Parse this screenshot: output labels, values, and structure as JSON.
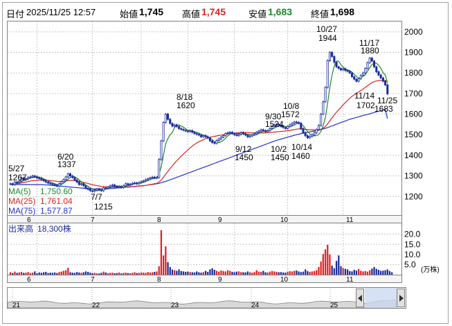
{
  "header": {
    "date_label": "日付",
    "datetime": "2025/11/25 12:57",
    "open_label": "始値",
    "open": "1,745",
    "high_label": "高値",
    "high": "1,745",
    "low_label": "安値",
    "low": "1,683",
    "close_label": "終値",
    "close": "1,698"
  },
  "ma_legend": [
    {
      "label": "MA(5)",
      "value": "1,750.60",
      "color": "#1a8a2a"
    },
    {
      "label": "MA(25)",
      "value": "1,761.04",
      "color": "#e02020"
    },
    {
      "label": "MA(75)",
      "value": "1,577.87",
      "color": "#2030d0"
    }
  ],
  "volume": {
    "title": "出来高",
    "value": "18,300株",
    "unit": "(万株)",
    "y_ticks": [
      "20.0",
      "15.0",
      "10.0",
      "5.0"
    ]
  },
  "colors": {
    "candle_up": "#ffffff",
    "candle_down": "#1a2aa0",
    "ma5": "#1a8a2a",
    "ma25": "#e02020",
    "ma75": "#2030d0",
    "volume_up": "#e02020",
    "volume_down": "#1a2aa0",
    "grid": "#c8c8c8"
  },
  "chart_data": {
    "type": "candlestick",
    "y_ticks": [
      1200,
      1300,
      1400,
      1500,
      1600,
      1700,
      1800,
      1900,
      2000
    ],
    "ylim": [
      1110,
      2050
    ],
    "x_month_labels": [
      "6",
      "7",
      "8",
      "9",
      "10",
      "11"
    ],
    "grid": true,
    "annotations": [
      {
        "date": "5/27",
        "price": 1267
      },
      {
        "date": "6/20",
        "price": 1337
      },
      {
        "date": "7/7",
        "price": 1215
      },
      {
        "date": "8/18",
        "price": 1620
      },
      {
        "date": "9/12",
        "price": 1450
      },
      {
        "date": "9/30",
        "price": 1524
      },
      {
        "date": "10/2",
        "price": 1450
      },
      {
        "date": "10/8",
        "price": 1572
      },
      {
        "date": "10/14",
        "price": 1460
      },
      {
        "date": "10/27",
        "price": 1944
      },
      {
        "date": "11/17",
        "price": 1880
      },
      {
        "date": "11/14",
        "price": 1702
      },
      {
        "date": "11/25",
        "price": 1683
      }
    ],
    "closes": [
      1262,
      1258,
      1270,
      1268,
      1275,
      1290,
      1282,
      1286,
      1292,
      1295,
      1300,
      1296,
      1290,
      1288,
      1282,
      1276,
      1270,
      1265,
      1262,
      1258,
      1255,
      1250,
      1262,
      1272,
      1282,
      1295,
      1310,
      1300,
      1292,
      1280,
      1270,
      1258,
      1262,
      1252,
      1240,
      1235,
      1228,
      1225,
      1230,
      1236,
      1232,
      1228,
      1242,
      1240,
      1246,
      1252,
      1256,
      1250,
      1246,
      1248,
      1244,
      1252,
      1262,
      1256,
      1260,
      1264,
      1266,
      1262,
      1268,
      1272,
      1276,
      1282,
      1286,
      1290,
      1294,
      1290,
      1292,
      1380,
      1470,
      1560,
      1600,
      1575,
      1555,
      1542,
      1548,
      1540,
      1530,
      1526,
      1522,
      1518,
      1515,
      1520,
      1512,
      1506,
      1502,
      1498,
      1490,
      1496,
      1490,
      1484,
      1470,
      1462,
      1458,
      1472,
      1480,
      1488,
      1496,
      1506,
      1510,
      1512,
      1506,
      1500,
      1496,
      1502,
      1510,
      1505,
      1498,
      1490,
      1494,
      1500,
      1505,
      1512,
      1518,
      1524,
      1520,
      1515,
      1520,
      1530,
      1542,
      1548,
      1550,
      1545,
      1540,
      1535,
      1530,
      1540,
      1548,
      1555,
      1562,
      1560,
      1556,
      1530,
      1510,
      1495,
      1485,
      1492,
      1500,
      1510,
      1525,
      1545,
      1600,
      1660,
      1730,
      1860,
      1900,
      1880,
      1852,
      1830,
      1822,
      1815,
      1820,
      1812,
      1808,
      1800,
      1782,
      1770,
      1760,
      1772,
      1788,
      1800,
      1822,
      1850,
      1872,
      1858,
      1830,
      1806,
      1790,
      1776,
      1760,
      1742,
      1698
    ],
    "ma5": [
      1262,
      1260,
      1263,
      1265,
      1267,
      1272,
      1277,
      1280,
      1285,
      1291,
      1291,
      1294,
      1295,
      1294,
      1291,
      1286,
      1281,
      1276,
      1270,
      1266,
      1262,
      1258,
      1257,
      1259,
      1264,
      1273,
      1284,
      1292,
      1296,
      1295,
      1290,
      1280,
      1272,
      1264,
      1256,
      1249,
      1243,
      1236,
      1233,
      1231,
      1230,
      1230,
      1234,
      1236,
      1238,
      1242,
      1247,
      1249,
      1250,
      1250,
      1249,
      1248,
      1250,
      1252,
      1255,
      1259,
      1262,
      1262,
      1264,
      1266,
      1269,
      1273,
      1277,
      1282,
      1286,
      1288,
      1290,
      1309,
      1345,
      1400,
      1456,
      1481,
      1500,
      1510,
      1535,
      1546,
      1548,
      1542,
      1537,
      1529,
      1522,
      1520,
      1518,
      1514,
      1512,
      1508,
      1502,
      1497,
      1494,
      1490,
      1484,
      1476,
      1467,
      1463,
      1462,
      1466,
      1473,
      1483,
      1494,
      1502,
      1507,
      1507,
      1506,
      1505,
      1506,
      1505,
      1503,
      1502,
      1501,
      1499,
      1498,
      1500,
      1506,
      1512,
      1516,
      1518,
      1519,
      1522,
      1527,
      1532,
      1538,
      1543,
      1545,
      1544,
      1540,
      1538,
      1539,
      1542,
      1547,
      1553,
      1556,
      1553,
      1544,
      1530,
      1515,
      1505,
      1497,
      1494,
      1496,
      1502,
      1516,
      1544,
      1585,
      1653,
      1730,
      1790,
      1834,
      1858,
      1857,
      1840,
      1828,
      1820,
      1815,
      1811,
      1804,
      1794,
      1783,
      1776,
      1777,
      1784,
      1791,
      1808,
      1826,
      1840,
      1850,
      1847,
      1838,
      1822,
      1802,
      1790,
      1751
    ],
    "ma25": [
      1262,
      1261,
      1262,
      1263,
      1264,
      1266,
      1268,
      1270,
      1272,
      1275,
      1277,
      1278,
      1278,
      1279,
      1279,
      1279,
      1279,
      1278,
      1277,
      1276,
      1275,
      1274,
      1273,
      1273,
      1274,
      1275,
      1277,
      1278,
      1278,
      1277,
      1275,
      1273,
      1271,
      1268,
      1266,
      1263,
      1260,
      1257,
      1255,
      1253,
      1251,
      1249,
      1248,
      1247,
      1246,
      1245,
      1245,
      1244,
      1244,
      1244,
      1244,
      1244,
      1245,
      1245,
      1246,
      1247,
      1248,
      1249,
      1250,
      1251,
      1252,
      1254,
      1256,
      1258,
      1260,
      1262,
      1264,
      1270,
      1280,
      1293,
      1308,
      1322,
      1336,
      1349,
      1362,
      1374,
      1385,
      1396,
      1406,
      1416,
      1426,
      1436,
      1445,
      1453,
      1460,
      1466,
      1471,
      1476,
      1481,
      1485,
      1488,
      1490,
      1492,
      1494,
      1496,
      1498,
      1500,
      1502,
      1504,
      1506,
      1507,
      1508,
      1509,
      1510,
      1511,
      1511,
      1511,
      1511,
      1510,
      1510,
      1509,
      1509,
      1509,
      1509,
      1509,
      1509,
      1510,
      1511,
      1512,
      1513,
      1514,
      1515,
      1516,
      1517,
      1518,
      1519,
      1521,
      1523,
      1525,
      1527,
      1528,
      1528,
      1527,
      1526,
      1525,
      1524,
      1524,
      1523,
      1523,
      1524,
      1527,
      1532,
      1540,
      1553,
      1568,
      1582,
      1596,
      1609,
      1621,
      1633,
      1645,
      1656,
      1667,
      1677,
      1686,
      1694,
      1701,
      1708,
      1715,
      1722,
      1730,
      1738,
      1746,
      1753,
      1758,
      1761,
      1763,
      1764,
      1764,
      1763,
      1761
    ],
    "ma75": [
      1258,
      1258,
      1258,
      1258,
      1258,
      1258,
      1258,
      1258,
      1258,
      1258,
      1258,
      1258,
      1258,
      1258,
      1258,
      1257,
      1256,
      1256,
      1255,
      1254,
      1253,
      1252,
      1251,
      1250,
      1249,
      1248,
      1247,
      1246,
      1245,
      1244,
      1243,
      1242,
      1241,
      1240,
      1239,
      1238,
      1238,
      1237,
      1237,
      1237,
      1237,
      1237,
      1237,
      1238,
      1238,
      1239,
      1239,
      1240,
      1241,
      1242,
      1243,
      1244,
      1245,
      1246,
      1247,
      1248,
      1249,
      1250,
      1251,
      1252,
      1253,
      1254,
      1256,
      1257,
      1259,
      1260,
      1262,
      1264,
      1267,
      1270,
      1273,
      1277,
      1281,
      1285,
      1289,
      1293,
      1297,
      1301,
      1305,
      1309,
      1313,
      1317,
      1321,
      1325,
      1329,
      1333,
      1337,
      1341,
      1345,
      1349,
      1353,
      1357,
      1361,
      1365,
      1369,
      1373,
      1377,
      1381,
      1385,
      1389,
      1393,
      1397,
      1401,
      1405,
      1409,
      1413,
      1417,
      1421,
      1425,
      1429,
      1433,
      1437,
      1441,
      1445,
      1449,
      1453,
      1457,
      1461,
      1465,
      1469,
      1473,
      1476,
      1479,
      1482,
      1485,
      1488,
      1491,
      1494,
      1497,
      1500,
      1503,
      1506,
      1508,
      1510,
      1512,
      1514,
      1516,
      1518,
      1520,
      1522,
      1525,
      1528,
      1531,
      1535,
      1539,
      1543,
      1547,
      1551,
      1555,
      1559,
      1563,
      1567,
      1571,
      1575,
      1578,
      1581,
      1584,
      1587,
      1590,
      1593,
      1596,
      1599,
      1602,
      1605,
      1608,
      1611,
      1614,
      1617,
      1620,
      1623,
      1578
    ],
    "volume": [
      1.2,
      0.8,
      1.5,
      0.9,
      1.1,
      1.4,
      0.9,
      1.0,
      1.3,
      0.8,
      1.0,
      1.6,
      0.7,
      1.1,
      0.9,
      1.2,
      1.4,
      0.8,
      1.0,
      0.9,
      1.1,
      0.8,
      1.3,
      1.5,
      1.9,
      2.2,
      3.4,
      1.2,
      1.0,
      0.9,
      1.3,
      1.1,
      0.9,
      1.2,
      1.6,
      1.4,
      1.0,
      0.8,
      0.9,
      0.7,
      0.6,
      0.9,
      1.5,
      1.1,
      0.8,
      0.9,
      1.0,
      0.7,
      0.8,
      1.1,
      0.6,
      0.9,
      1.0,
      0.8,
      0.7,
      0.9,
      1.2,
      0.8,
      0.9,
      1.1,
      1.0,
      0.9,
      1.3,
      1.1,
      1.2,
      1.4,
      1.6,
      4.2,
      22.0,
      9.5,
      14.0,
      6.2,
      3.8,
      2.5,
      2.2,
      1.9,
      2.6,
      1.8,
      1.6,
      1.4,
      1.5,
      1.3,
      1.2,
      1.1,
      1.6,
      1.2,
      1.0,
      1.3,
      1.9,
      1.4,
      2.6,
      3.2,
      2.4,
      1.9,
      1.5,
      2.1,
      1.8,
      1.6,
      2.2,
      1.9,
      1.4,
      1.2,
      1.5,
      1.6,
      1.3,
      1.2,
      1.1,
      1.6,
      1.2,
      1.0,
      1.3,
      2.2,
      1.5,
      1.4,
      1.9,
      1.2,
      1.1,
      1.5,
      1.8,
      1.6,
      1.4,
      1.2,
      1.3,
      1.1,
      1.0,
      1.4,
      1.7,
      1.6,
      1.9,
      2.1,
      1.6,
      1.3,
      1.5,
      2.6,
      1.8,
      1.4,
      1.6,
      1.8,
      2.2,
      3.8,
      6.5,
      10.2,
      12.5,
      14.8,
      10.0,
      4.5,
      3.2,
      6.8,
      9.5,
      4.2,
      3.3,
      2.9,
      2.6,
      1.8,
      1.6,
      2.4,
      2.0,
      2.8,
      1.9,
      1.6,
      1.8,
      1.5,
      2.2,
      3.0,
      3.8,
      2.9,
      2.4,
      1.9,
      2.0,
      2.2,
      2.6,
      1.8,
      1.2
    ],
    "navigator_labels": [
      "21",
      "22",
      "23",
      "24",
      "25"
    ]
  }
}
